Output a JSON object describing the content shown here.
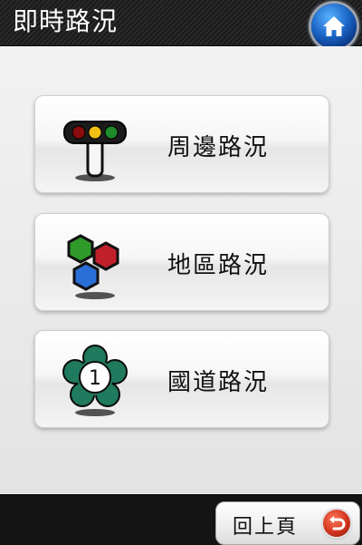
{
  "header": {
    "title": "即時路況",
    "home_icon": "home-icon"
  },
  "menu": {
    "items": [
      {
        "label": "周邊路況",
        "icon": "traffic-light-icon"
      },
      {
        "label": "地區路況",
        "icon": "region-hexagons-icon"
      },
      {
        "label": "國道路況",
        "icon": "national-highway-icon",
        "badge": "1"
      }
    ]
  },
  "footer": {
    "back_label": "回上頁",
    "back_icon": "back-arrow-icon"
  },
  "colors": {
    "header_bg": "#1f1f1f",
    "home_blue": "#1a66c8",
    "back_red": "#d0341d",
    "hex_red": "#c0202a",
    "hex_green": "#2f9a2a",
    "hex_blue": "#2a6fd6"
  }
}
